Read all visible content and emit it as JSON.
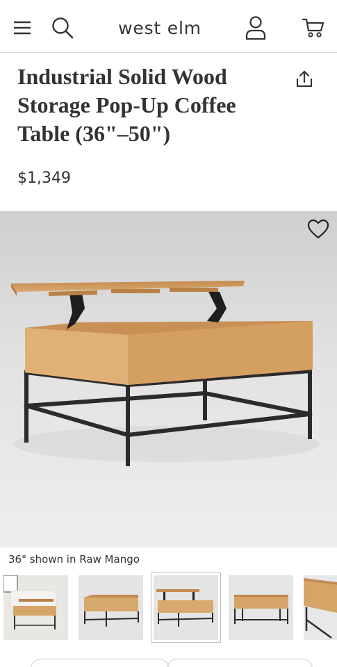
{
  "header": {
    "logo_text": "west elm",
    "icons": [
      "menu-icon",
      "search-icon",
      "account-icon",
      "cart-icon"
    ]
  },
  "product": {
    "title": "Industrial Solid Wood Storage Pop-Up Coffee Table (36\"–50\")",
    "price": "$1,349",
    "image_caption": "36\" shown in Raw Mango"
  },
  "colors": {
    "text": "#333333",
    "wood": "#d9a96b",
    "metal": "#2b2b2b",
    "divider": "#d9d9d9"
  }
}
